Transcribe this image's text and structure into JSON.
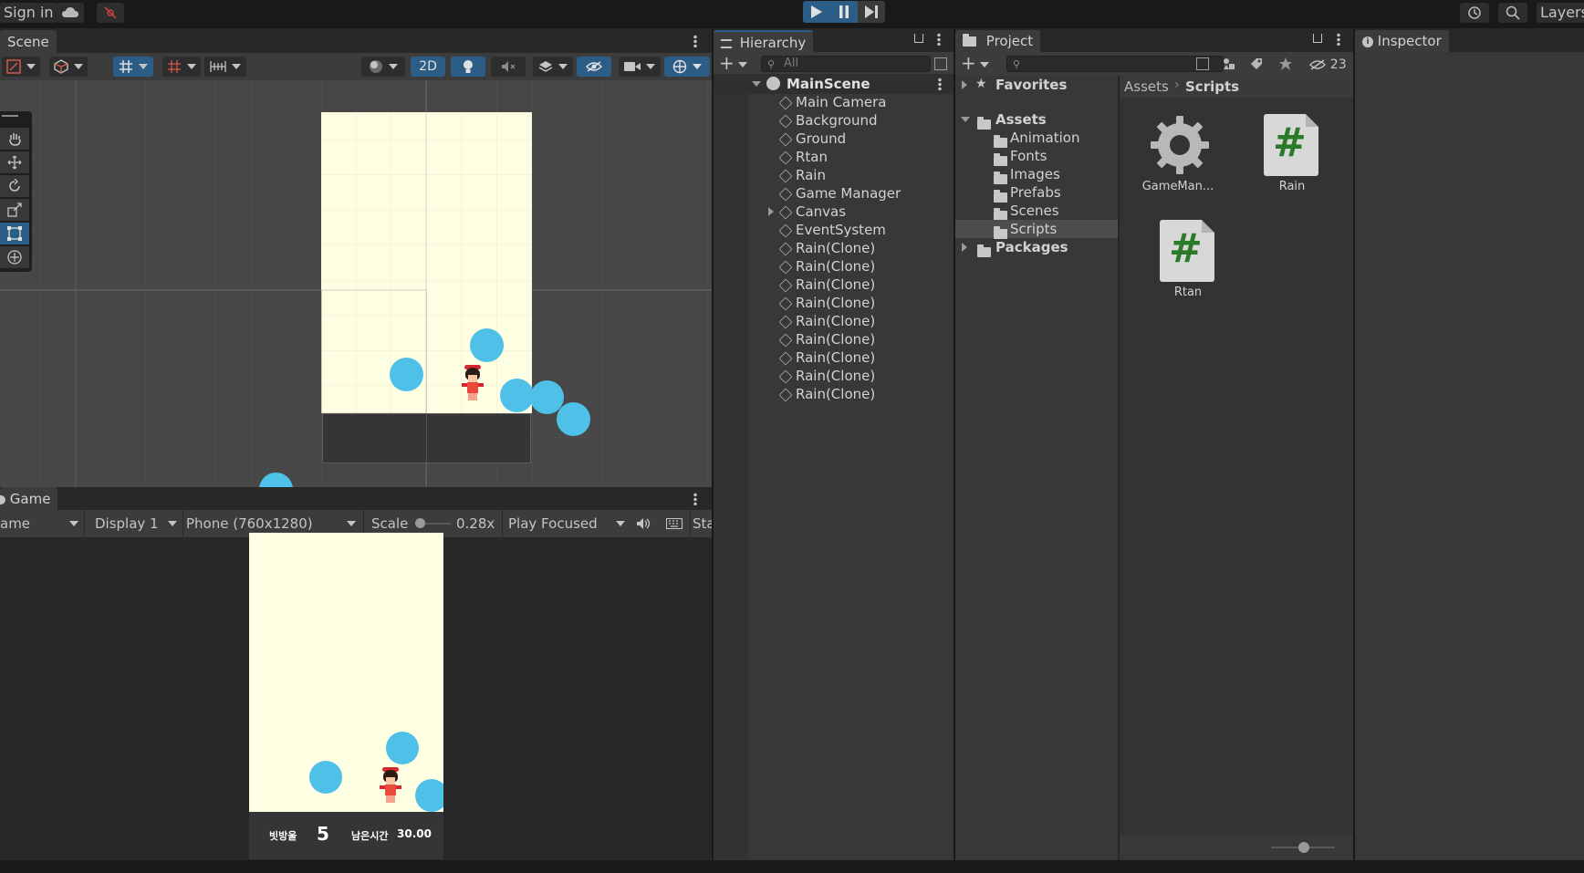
{
  "topbar": {
    "sign_in": "Sign in",
    "layers": "Layers"
  },
  "scene": {
    "tab": "Scene",
    "mode_2d": "2D"
  },
  "game": {
    "tab": "Game",
    "view_mode": "ame",
    "display": "Display 1",
    "resolution": "Phone (760x1280)",
    "scale_label": "Scale",
    "scale_value": "0.28x",
    "play_mode": "Play Focused",
    "stats_label": "Sta",
    "hud": {
      "score_label": "빗방울",
      "score_value": "5",
      "time_label": "남은시간",
      "time_value": "30.00"
    }
  },
  "hierarchy": {
    "tab": "Hierarchy",
    "search_placeholder": "All",
    "scene_name": "MainScene",
    "items": [
      {
        "label": "Main Camera"
      },
      {
        "label": "Background"
      },
      {
        "label": "Ground"
      },
      {
        "label": "Rtan"
      },
      {
        "label": "Rain"
      },
      {
        "label": "Game Manager"
      },
      {
        "label": "Canvas"
      },
      {
        "label": "EventSystem"
      },
      {
        "label": "Rain(Clone)"
      },
      {
        "label": "Rain(Clone)"
      },
      {
        "label": "Rain(Clone)"
      },
      {
        "label": "Rain(Clone)"
      },
      {
        "label": "Rain(Clone)"
      },
      {
        "label": "Rain(Clone)"
      },
      {
        "label": "Rain(Clone)"
      },
      {
        "label": "Rain(Clone)"
      },
      {
        "label": "Rain(Clone)"
      }
    ]
  },
  "project": {
    "tab": "Project",
    "hidden_count": "23",
    "favorites": "Favorites",
    "assets": "Assets",
    "folders": [
      "Animation",
      "Fonts",
      "Images",
      "Prefabs",
      "Scenes",
      "Scripts"
    ],
    "packages": "Packages",
    "breadcrumb": [
      "Assets",
      "Scripts"
    ],
    "files": [
      {
        "name": "GameMan...",
        "icon": "gear-icon"
      },
      {
        "name": "Rain",
        "icon": "csharp-script-icon"
      },
      {
        "name": "Rtan",
        "icon": "csharp-script-icon"
      }
    ]
  },
  "inspector": {
    "tab": "Inspector"
  },
  "colors": {
    "accent": "#2c5d87",
    "rain": "#4fc1e9",
    "background": "#fefee2"
  }
}
